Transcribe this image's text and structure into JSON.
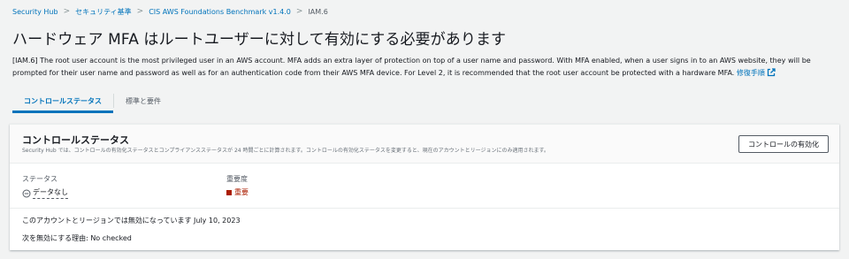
{
  "breadcrumb": {
    "items": [
      "Security Hub",
      "セキュリティ基準",
      "CIS AWS Foundations Benchmark v1.4.0"
    ],
    "current": "IAM.6"
  },
  "page": {
    "title": "ハードウェア MFA はルートユーザーに対して有効にする必要があります",
    "description": "[IAM.6] The root user account is the most privileged user in an AWS account. MFA adds an extra layer of protection on top of a user name and password. With MFA enabled, when a user signs in to an AWS website, they will be prompted for their user name and password as well as for an authentication code from their AWS MFA device. For Level 2, it is recommended that the root user account be protected with a hardware MFA.",
    "remediation_link": "修復手順"
  },
  "tabs": [
    {
      "label": "コントロールステータス",
      "active": true
    },
    {
      "label": "標準と要件",
      "active": false
    }
  ],
  "panel": {
    "title": "コントロールステータス",
    "subtitle": "Security Hub では、コントロールの有効化ステータスとコンプライアンスステータスが 24 時間ごとに計算されます。コントロールの有効化ステータスを変更すると、現在のアカウントとリージョンにのみ適用されます。",
    "enable_button": "コントロールの有効化",
    "status_label": "ステータス",
    "status_value": "データなし",
    "severity_label": "重要度",
    "severity_value": "重要",
    "disabled_info": "このアカウントとリージョンでは無効になっています July 10, 2023",
    "disable_reason": "次を無効にする理由: No checked"
  },
  "colors": {
    "link": "#0073bb",
    "severity_critical": "#ab1d00"
  }
}
